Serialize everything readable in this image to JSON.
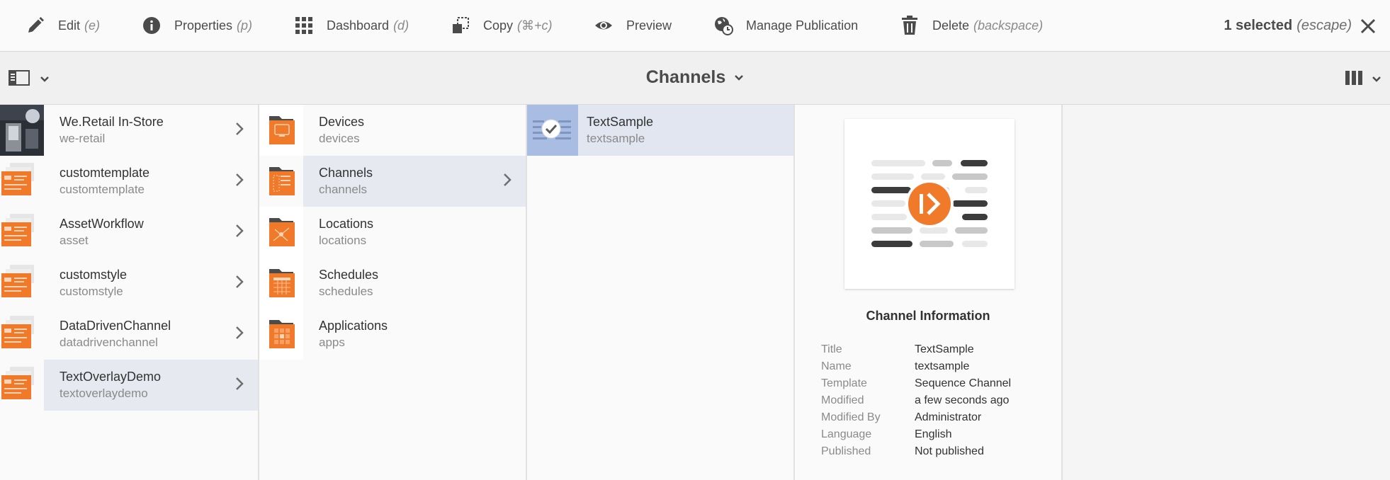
{
  "actionbar": {
    "actions": [
      {
        "label": "Edit",
        "shortcut": "(e)",
        "icon": "pencil-icon"
      },
      {
        "label": "Properties",
        "shortcut": "(p)",
        "icon": "info-icon"
      },
      {
        "label": "Dashboard",
        "shortcut": "(d)",
        "icon": "grid-icon"
      },
      {
        "label": "Copy",
        "shortcut": "(⌘+c)",
        "icon": "copy-icon"
      },
      {
        "label": "Preview",
        "shortcut": "",
        "icon": "eye-icon"
      },
      {
        "label": "Manage Publication",
        "shortcut": "",
        "icon": "globe-clock-icon"
      },
      {
        "label": "Delete",
        "shortcut": "(backspace)",
        "icon": "trash-icon"
      }
    ],
    "selection_label": "1 selected",
    "selection_shortcut": "(escape)"
  },
  "titlebar": {
    "title": "Channels"
  },
  "columns": {
    "col1": [
      {
        "title": "We.Retail In-Store",
        "name": "we-retail",
        "has_children": true,
        "thumb": "photo"
      },
      {
        "title": "customtemplate",
        "name": "customtemplate",
        "has_children": true,
        "thumb": "project"
      },
      {
        "title": "AssetWorkflow",
        "name": "asset",
        "has_children": true,
        "thumb": "project"
      },
      {
        "title": "customstyle",
        "name": "customstyle",
        "has_children": true,
        "thumb": "project"
      },
      {
        "title": "DataDrivenChannel",
        "name": "datadrivenchannel",
        "has_children": true,
        "thumb": "project"
      },
      {
        "title": "TextOverlayDemo",
        "name": "textoverlaydemo",
        "has_children": true,
        "thumb": "project",
        "active": true
      }
    ],
    "col2": [
      {
        "title": "Devices",
        "name": "devices",
        "has_children": false,
        "thumb": "folder-devices"
      },
      {
        "title": "Channels",
        "name": "channels",
        "has_children": true,
        "thumb": "folder-channels",
        "active": true
      },
      {
        "title": "Locations",
        "name": "locations",
        "has_children": false,
        "thumb": "folder-locations"
      },
      {
        "title": "Schedules",
        "name": "schedules",
        "has_children": false,
        "thumb": "folder-schedules"
      },
      {
        "title": "Applications",
        "name": "apps",
        "has_children": false,
        "thumb": "folder-apps"
      }
    ],
    "col3": [
      {
        "title": "TextSample",
        "name": "textsample",
        "has_children": false,
        "thumb": "selected-check",
        "selected": true
      }
    ]
  },
  "details": {
    "heading": "Channel Information",
    "rows": [
      {
        "key": "Title",
        "value": "TextSample"
      },
      {
        "key": "Name",
        "value": "textsample"
      },
      {
        "key": "Template",
        "value": "Sequence Channel"
      },
      {
        "key": "Modified",
        "value": "a few seconds ago"
      },
      {
        "key": "Modified By",
        "value": "Administrator"
      },
      {
        "key": "Language",
        "value": "English"
      },
      {
        "key": "Published",
        "value": "Not published"
      }
    ]
  },
  "colors": {
    "accent": "#f0792a",
    "selected_row": "#e1e6f0",
    "icon_gray": "#4b4b4b"
  }
}
